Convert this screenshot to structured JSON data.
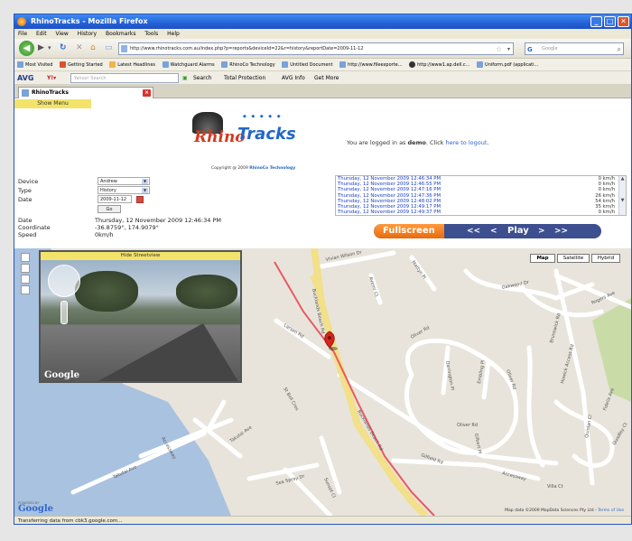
{
  "window": {
    "title": "RhinoTracks - Mozilla Firefox"
  },
  "menu": [
    "File",
    "Edit",
    "View",
    "History",
    "Bookmarks",
    "Tools",
    "Help"
  ],
  "nav": {
    "url": "http://www.rhinotracks.com.au/index.php?p=reports&deviceId=22&r=history&reportDate=2009-11-12",
    "search_placeholder": "Google"
  },
  "bookmarks": [
    "Most Visited",
    "Getting Started",
    "Latest Headlines",
    "Watchguard Alarms",
    "RhinoCo Technology",
    "Untitled Document",
    "http://www.fileexporte...",
    "http://www1.ap.dell.c...",
    "Uniform.pdf (applicati..."
  ],
  "avgbar": {
    "logo": "AVG",
    "search_placeholder": "Yahoo! Search",
    "items": [
      "Search",
      "Total Protection",
      "AVG Info",
      "Get More"
    ]
  },
  "tab": {
    "title": "RhinoTracks"
  },
  "page": {
    "show_menu": "Show Menu",
    "logo_rhino": "Rhino",
    "logo_tracks": "Tracks",
    "copyright_prefix": "Copyright @ 2009 ",
    "copyright_brand": "RhinoCo Technology",
    "login_prefix": "You are logged in as ",
    "login_user": "demo",
    "login_mid": ". Click ",
    "login_link": "here to logout",
    "login_suffix": "."
  },
  "form": {
    "device_label": "Device",
    "device_value": "Andrew",
    "type_label": "Type",
    "type_value": "History",
    "date_label": "Date",
    "date_value": "2009-11-12",
    "go_label": "Go",
    "date2_label": "Date",
    "date2_value": "Thursday, 12 November 2009 12:46:34 PM",
    "coord_label": "Coordinate",
    "coord_value": "-36.8759°, 174.9079°",
    "speed_label": "Speed",
    "speed_value": "0km/h"
  },
  "track_list": [
    {
      "time": "Thursday, 12 November 2009 12:46:34 PM",
      "speed": "0 km/h"
    },
    {
      "time": "Thursday, 12 November 2009 12:46:55 PM",
      "speed": "0 km/h"
    },
    {
      "time": "Thursday, 12 November 2009 12:47:16 PM",
      "speed": "0 km/h"
    },
    {
      "time": "Thursday, 12 November 2009 12:47:36 PM",
      "speed": "26 km/h"
    },
    {
      "time": "Thursday, 12 November 2009 12:48:02 PM",
      "speed": "54 km/h"
    },
    {
      "time": "Thursday, 12 November 2009 12:49:17 PM",
      "speed": "35 km/h"
    },
    {
      "time": "Thursday, 12 November 2009 12:49:37 PM",
      "speed": "0 km/h"
    }
  ],
  "playback": {
    "fullscreen": "Fullscreen",
    "first": "<<",
    "prev": "<",
    "play": "Play",
    "next": ">",
    "last": ">>"
  },
  "map": {
    "types": [
      "Map",
      "Satellite",
      "Hybrid"
    ],
    "hide_streetview": "Hide Streetview",
    "google": "Google",
    "powered_by": "POWERED BY",
    "map_data": "Map data ©2009 MapData Sciences Pty Ltd -",
    "terms": "Terms of Use",
    "roads": {
      "vivian": "Vivian Wilson Dr",
      "avenir": "Avenir Ct",
      "mattyn": "Mattyn Pl",
      "oakwood": "Oakwood Dr",
      "rogers": "Rogers Ave",
      "howick": "Howick Access Rd",
      "buckland1": "Bucklands Beach Rd",
      "buckland2": "Bucklands Beach Rd",
      "larsen": "Larsen Rd",
      "oliver1": "Oliver Rd",
      "oliver2": "Oliver Rd",
      "oliver3": "Oliver Rd",
      "embling": "Embling Pl",
      "darrington": "Darrington Pl",
      "gilbert": "Gilbert Pl",
      "accessway1": "Accessway",
      "accessway2": "Accessway",
      "villa": "Villa Ct",
      "gilfield": "Gilfield Rd",
      "takutai1": "Takutai Ave",
      "takutai2": "Takutai Ave",
      "searey": "Sea Spray Dr",
      "sunset": "Sunset Cl",
      "bell": "St Bell Cres",
      "brunswick": "Brunswick Rd",
      "quinlan": "Quinlan Cl",
      "fidelis": "Fidelis Ave",
      "quadley": "Quadley Ct"
    }
  },
  "status": "Transferring data from cbk3.google.com..."
}
